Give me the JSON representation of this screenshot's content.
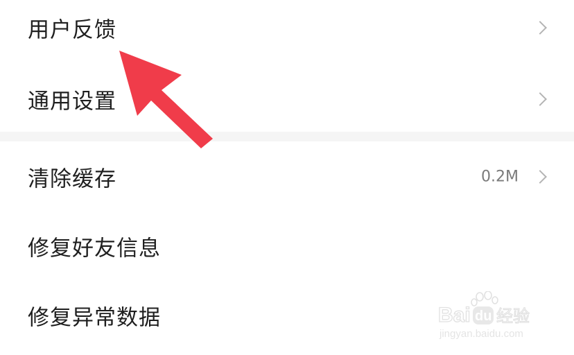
{
  "settings": {
    "items": [
      {
        "label": "用户反馈",
        "value": "",
        "has_chevron": true
      },
      {
        "label": "通用设置",
        "value": "",
        "has_chevron": true
      },
      {
        "label": "清除缓存",
        "value": "0.2M",
        "has_chevron": true
      },
      {
        "label": "修复好友信息",
        "value": "",
        "has_chevron": false
      },
      {
        "label": "修复异常数据",
        "value": "",
        "has_chevron": false
      }
    ]
  },
  "annotation": {
    "arrow_color": "#f03c4a",
    "arrow_icon": "red-pointer-arrow-icon"
  },
  "watermark": {
    "brand": "Baidu经验",
    "url": "jingyan.baidu.com"
  },
  "colors": {
    "text_primary": "#1f1f1f",
    "text_secondary": "#7a7a7a",
    "chevron": "#b4b4b4",
    "section_gap": "#f5f5f5"
  }
}
